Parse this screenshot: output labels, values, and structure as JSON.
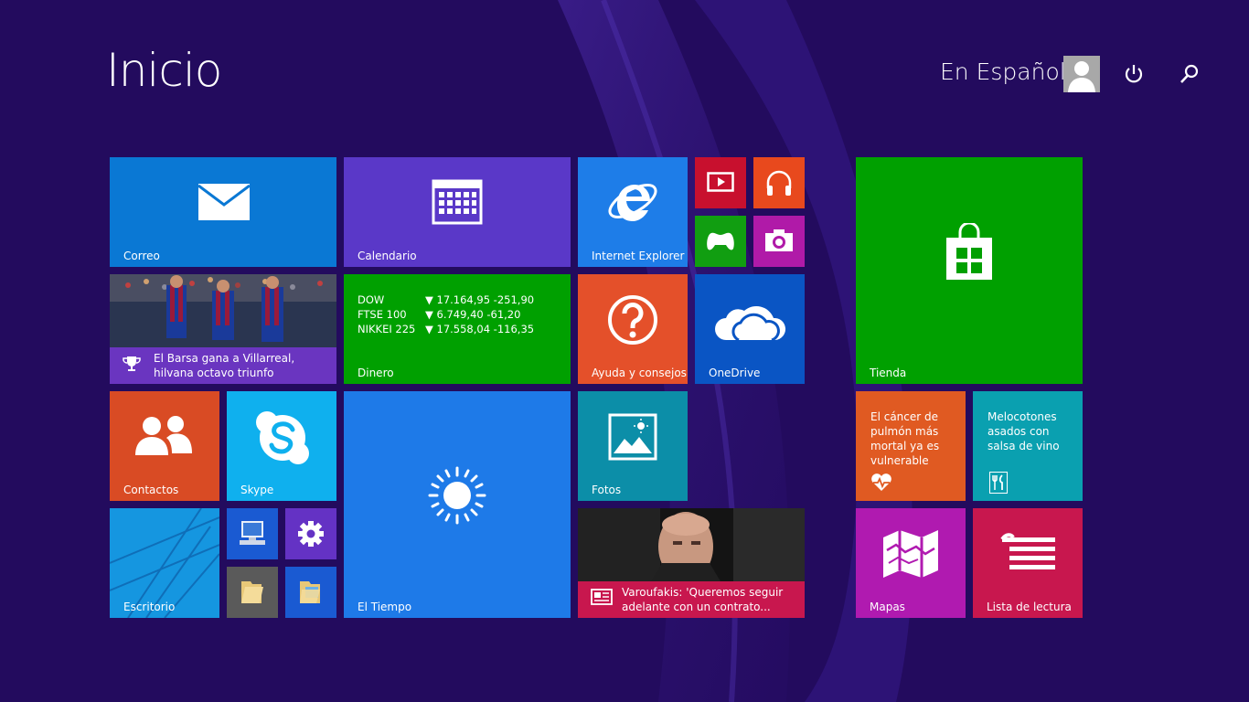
{
  "header": {
    "title": "Inicio",
    "user_name": "En Español"
  },
  "tiles": {
    "correo": {
      "label": "Correo",
      "color": "#0a78d4"
    },
    "calendario": {
      "label": "Calendario",
      "color": "#5a38c8"
    },
    "internet_explorer": {
      "label": "Internet Explorer",
      "color": "#1e7de8"
    },
    "video": {
      "color": "#c8102e"
    },
    "music": {
      "color": "#e8491d"
    },
    "games": {
      "color": "#119e11"
    },
    "camera": {
      "color": "#b01aa8"
    },
    "tienda": {
      "label": "Tienda",
      "color": "#00a000"
    },
    "deportes": {
      "headline": "El Barsa gana a Villarreal, hilvana octavo triunfo",
      "color": "#6a35c0"
    },
    "dinero": {
      "label": "Dinero",
      "color": "#00a000",
      "stocks": [
        {
          "name": "DOW",
          "value": "▼ 17.164,95 -251,90"
        },
        {
          "name": "FTSE 100",
          "value": "▼ 6.749,40 -61,20"
        },
        {
          "name": "NIKKEI 225",
          "value": "▼ 17.558,04 -116,35"
        }
      ]
    },
    "ayuda": {
      "label": "Ayuda y consejos",
      "color": "#e4502a"
    },
    "onedrive": {
      "label": "OneDrive",
      "color": "#0a55c4"
    },
    "contactos": {
      "label": "Contactos",
      "color": "#d94b24"
    },
    "skype": {
      "label": "Skype",
      "color": "#0fb0ee"
    },
    "el_tiempo": {
      "label": "El Tiempo",
      "color": "#1e7ae8"
    },
    "fotos": {
      "label": "Fotos",
      "color": "#0c8ea8"
    },
    "salud": {
      "headline": "El cáncer de pulmón más mortal ya es vulnerable",
      "color": "#e05a22"
    },
    "cocina": {
      "headline": "Melocotones asados con salsa de vino",
      "color": "#0aa0b0"
    },
    "escritorio": {
      "label": "Escritorio",
      "color": "#1596e0"
    },
    "este_equipo": {
      "color": "#1a5ad2"
    },
    "configuracion": {
      "color": "#6432c4"
    },
    "explorador": {
      "color": "#5a5a5a"
    },
    "bibliotecas": {
      "color": "#1a5ad2"
    },
    "noticias": {
      "headline": "Varoufakis: 'Queremos seguir adelante con un contrato...",
      "color": "#c8174e"
    },
    "mapas": {
      "label": "Mapas",
      "color": "#b01ab0"
    },
    "lista_lectura": {
      "label": "Lista de lectura",
      "color": "#c8174e"
    }
  }
}
